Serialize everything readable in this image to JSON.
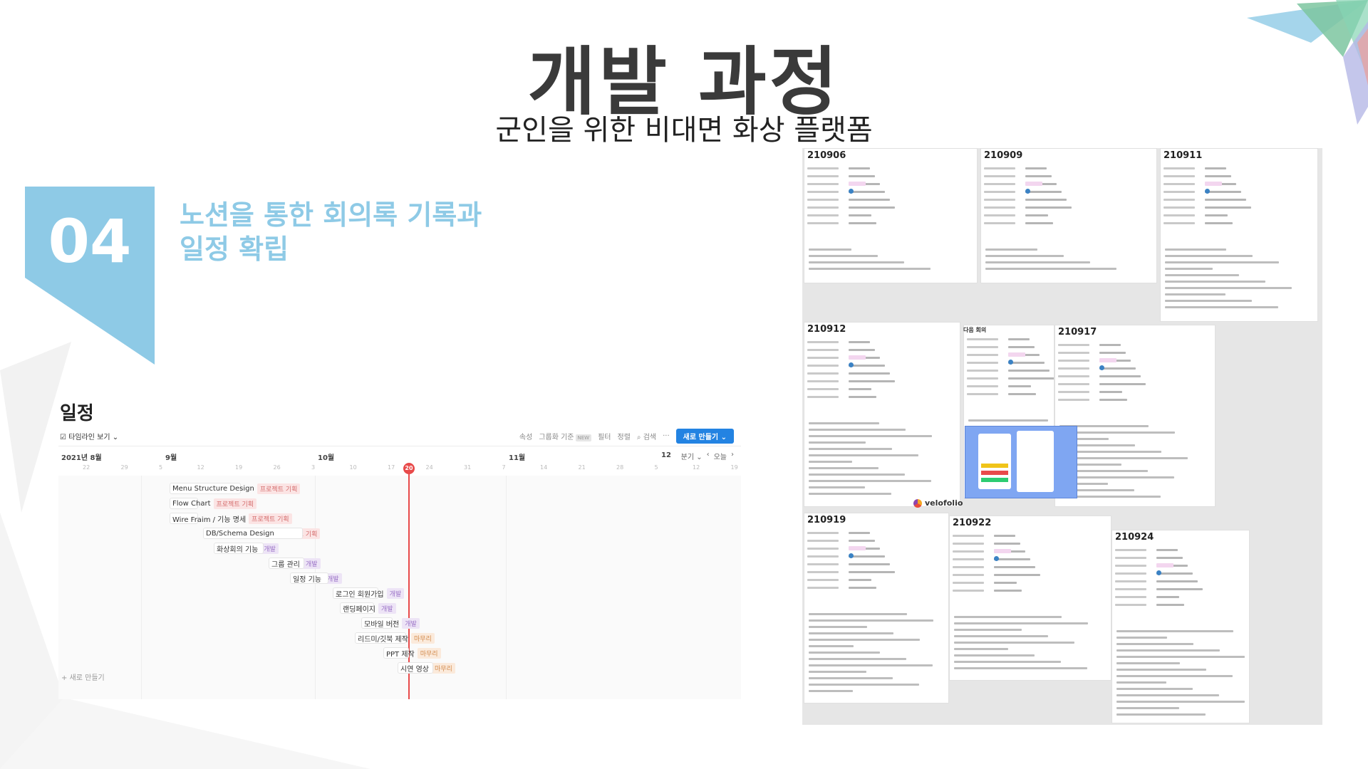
{
  "slide": {
    "title": "개발 과정",
    "subtitle": "군인을 위한 비대면 화상 플랫폼"
  },
  "section": {
    "number": "04",
    "heading_line1": "노션을 통한 회의록 기록과",
    "heading_line2": "일정 확립"
  },
  "timeline": {
    "title": "일정",
    "view_toggle": "타임라인 보기",
    "toolbar": {
      "property": "속성",
      "group_by": "그룹화 기준",
      "group_badge": "NEW",
      "filter": "필터",
      "sort": "정렬",
      "search": "검색",
      "more": "···",
      "new_button": "새로 만들기"
    },
    "months": [
      "2021년 8월",
      "9월",
      "10월",
      "11월",
      "12"
    ],
    "days": [
      "22",
      "29",
      "5",
      "12",
      "19",
      "26",
      "3",
      "10",
      "17",
      "24",
      "31",
      "7",
      "14",
      "21",
      "28",
      "5",
      "12",
      "19"
    ],
    "today": "20",
    "nav": {
      "view": "분기",
      "today": "오늘"
    },
    "tasks": [
      {
        "name": "Menu Structure Design",
        "tag": "프로젝트 기획",
        "tag_type": "plan"
      },
      {
        "name": "Flow Chart",
        "tag": "프로젝트 기획",
        "tag_type": "plan"
      },
      {
        "name": "Wire Fraim / 기능 명세",
        "tag": "프로젝트 기획",
        "tag_type": "plan"
      },
      {
        "name": "DB/Schema Design",
        "tag": "프로젝트 기획",
        "tag_type": "plan"
      },
      {
        "name": "화상회의 기능",
        "tag": "개발",
        "tag_type": "dev"
      },
      {
        "name": "그룹 관리",
        "tag": "개발",
        "tag_type": "dev"
      },
      {
        "name": "일정 기능",
        "tag": "개발",
        "tag_type": "dev"
      },
      {
        "name": "로그인 회원가입",
        "tag": "개발",
        "tag_type": "dev"
      },
      {
        "name": "랜딩페이지",
        "tag": "개발",
        "tag_type": "dev"
      },
      {
        "name": "모바일 버전",
        "tag": "개발",
        "tag_type": "dev"
      },
      {
        "name": "리드미/깃북 제작",
        "tag": "마무리",
        "tag_type": "fin"
      },
      {
        "name": "PPT 제작",
        "tag": "마무리",
        "tag_type": "fin"
      },
      {
        "name": "시연 영상",
        "tag": "마무리",
        "tag_type": "fin"
      }
    ],
    "add_new": "+ 새로 만들기"
  },
  "notes": {
    "titles": [
      "210906",
      "210909",
      "210911",
      "210912",
      "210917",
      "210919",
      "210922",
      "210924"
    ],
    "next_meeting": "다음 회의",
    "velofolio": "velofolio"
  }
}
